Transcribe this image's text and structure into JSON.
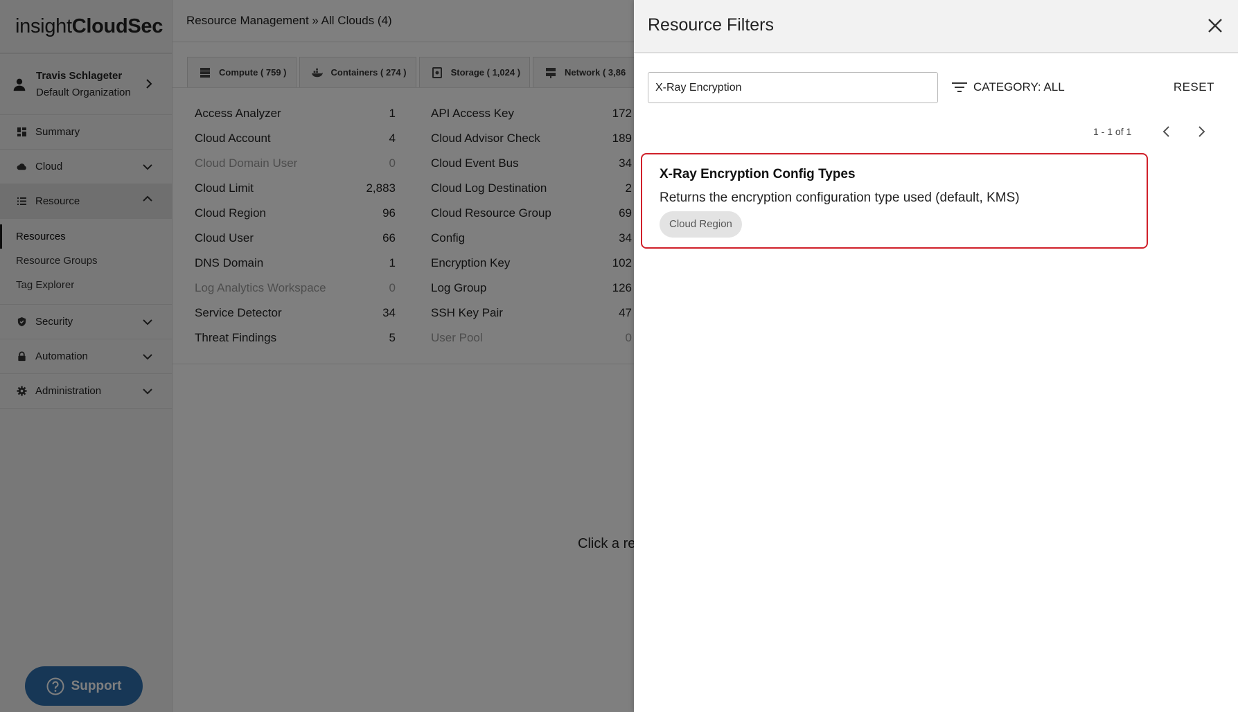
{
  "brand": {
    "prefix": "insight",
    "suffix": "CloudSec"
  },
  "user": {
    "name": "Travis Schlageter",
    "org": "Default Organization"
  },
  "nav": {
    "summary": "Summary",
    "cloud": "Cloud",
    "resource": "Resource",
    "resource_sub": [
      "Resources",
      "Resource Groups",
      "Tag Explorer"
    ],
    "security": "Security",
    "automation": "Automation",
    "administration": "Administration"
  },
  "support_label": "Support",
  "breadcrumb": "Resource Management » All Clouds (4)",
  "tabs": [
    {
      "label": "Compute ( 759 )"
    },
    {
      "label": "Containers ( 274 )"
    },
    {
      "label": "Storage ( 1,024 )"
    },
    {
      "label": "Network ( 3,86"
    }
  ],
  "resources_left": [
    {
      "name": "Access Analyzer",
      "count": "1"
    },
    {
      "name": "Cloud Account",
      "count": "4"
    },
    {
      "name": "Cloud Domain User",
      "count": "0"
    },
    {
      "name": "Cloud Limit",
      "count": "2,883"
    },
    {
      "name": "Cloud Region",
      "count": "96"
    },
    {
      "name": "Cloud User",
      "count": "66"
    },
    {
      "name": "DNS Domain",
      "count": "1"
    },
    {
      "name": "Log Analytics Workspace",
      "count": "0"
    },
    {
      "name": "Service Detector",
      "count": "34"
    },
    {
      "name": "Threat Findings",
      "count": "5"
    }
  ],
  "resources_right": [
    {
      "name": "API Access Key",
      "count": "172"
    },
    {
      "name": "Cloud Advisor Check",
      "count": "189"
    },
    {
      "name": "Cloud Event Bus",
      "count": "34"
    },
    {
      "name": "Cloud Log Destination",
      "count": "2"
    },
    {
      "name": "Cloud Resource Group",
      "count": "69"
    },
    {
      "name": "Config",
      "count": "34"
    },
    {
      "name": "Encryption Key",
      "count": "102"
    },
    {
      "name": "Log Group",
      "count": "126"
    },
    {
      "name": "SSH Key Pair",
      "count": "47"
    },
    {
      "name": "User Pool",
      "count": "0"
    }
  ],
  "hint_text": "Click a re",
  "drawer": {
    "title": "Resource Filters",
    "search_value": "X-Ray Encryption",
    "category_label": "CATEGORY: ALL",
    "reset_label": "RESET",
    "pager_text": "1 - 1 of 1",
    "result": {
      "title": "X-Ray Encryption Config Types",
      "description": "Returns the encryption configuration type used (default, KMS)",
      "tag": "Cloud Region"
    }
  },
  "colors": {
    "accent": "#2f6fad",
    "highlight": "#d0202a",
    "overlay": "rgba(0,0,0,0.5)"
  }
}
